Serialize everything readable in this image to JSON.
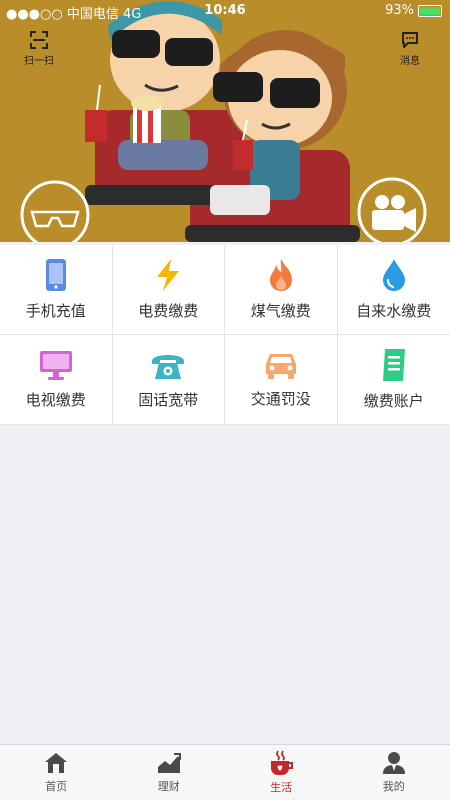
{
  "status": {
    "carrier": "●●●○○ 中国电信 4G",
    "time": "10:46",
    "battery": "93%",
    "battery_level": 0.93
  },
  "banner": {
    "scan_label": "扫一扫",
    "message_label": "消息"
  },
  "services": [
    {
      "label": "手机充值",
      "icon": "phone-icon",
      "color": "#5a8be0"
    },
    {
      "label": "电费缴费",
      "icon": "lightning-icon",
      "color": "#f5b800"
    },
    {
      "label": "煤气缴费",
      "icon": "flame-icon",
      "color": "#f27c3f"
    },
    {
      "label": "自来水缴费",
      "icon": "water-drop-icon",
      "color": "#2d9ae6"
    },
    {
      "label": "电视缴费",
      "icon": "tv-icon",
      "color": "#d264d6"
    },
    {
      "label": "固话宽带",
      "icon": "telephone-icon",
      "color": "#3fb3c4"
    },
    {
      "label": "交通罚没",
      "icon": "car-icon",
      "color": "#f5a869"
    },
    {
      "label": "缴费账户",
      "icon": "account-book-icon",
      "color": "#2fcc85"
    }
  ],
  "tabs": [
    {
      "label": "首页",
      "icon": "home-icon",
      "active": false
    },
    {
      "label": "理财",
      "icon": "finance-chart-icon",
      "active": false
    },
    {
      "label": "生活",
      "icon": "life-cup-icon",
      "active": true
    },
    {
      "label": "我的",
      "icon": "profile-icon",
      "active": false
    }
  ],
  "colors": {
    "accent": "#c2272d",
    "banner_bg": "#b98d2a"
  }
}
